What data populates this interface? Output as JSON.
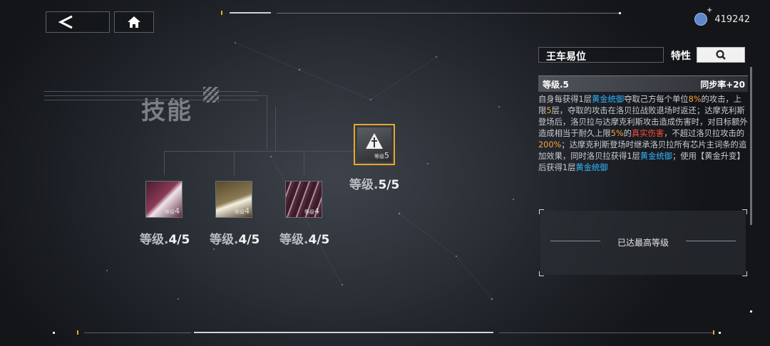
{
  "currency": {
    "icon": "gem-icon",
    "amount": "419242"
  },
  "skills_title": "技能",
  "nodes": [
    {
      "name": "skill-node-1",
      "level_prefix": "等级",
      "level": "4",
      "label_prefix": "等级.",
      "label_value": "4/5"
    },
    {
      "name": "skill-node-2",
      "level_prefix": "等级",
      "level": "4",
      "label_prefix": "等级.",
      "label_value": "4/5"
    },
    {
      "name": "skill-node-3",
      "level_prefix": "等级",
      "level": "4",
      "label_prefix": "等级.",
      "label_value": "4/5"
    },
    {
      "name": "skill-node-main",
      "level_prefix": "等级",
      "level": "5",
      "label_prefix": "等级.",
      "label_value": "5/5"
    }
  ],
  "panel": {
    "skill_name": "王车易位",
    "trait_label": "特性",
    "level_text": "等级.5",
    "sync_text": "同步率+20",
    "desc": {
      "p1": "自身每获得1层",
      "gold1": "黄金统御",
      "p2": "夺取己方每个单位",
      "pct8": "8%",
      "p3": "的攻击，上限",
      "layers5": "5",
      "p4": "层，夺取的攻击在洛贝拉战败退场时返还；达摩克利斯登场后，洛贝拉与达摩克利斯攻击造成伤害时，对目标额外造成相当于耐久上限",
      "pct5": "5%",
      "p5": "的",
      "true_dmg": "真实伤害",
      "p6": "，不超过洛贝拉攻击的",
      "pct200": "200%",
      "p7": "；达摩克利斯登场时继承洛贝拉所有芯片主词条的追加效果，同时洛贝拉获得1层",
      "gold2": "黄金统御",
      "p8": "；使用【黄金升变】后获得1层",
      "gold3": "黄金统御"
    },
    "max_level_text": "已达最高等级"
  },
  "colors": {
    "accent": "#e8a72a",
    "blue_highlight": "#35b6ff",
    "orange_highlight": "#ffa23a",
    "red_highlight": "#ff4d3a"
  }
}
